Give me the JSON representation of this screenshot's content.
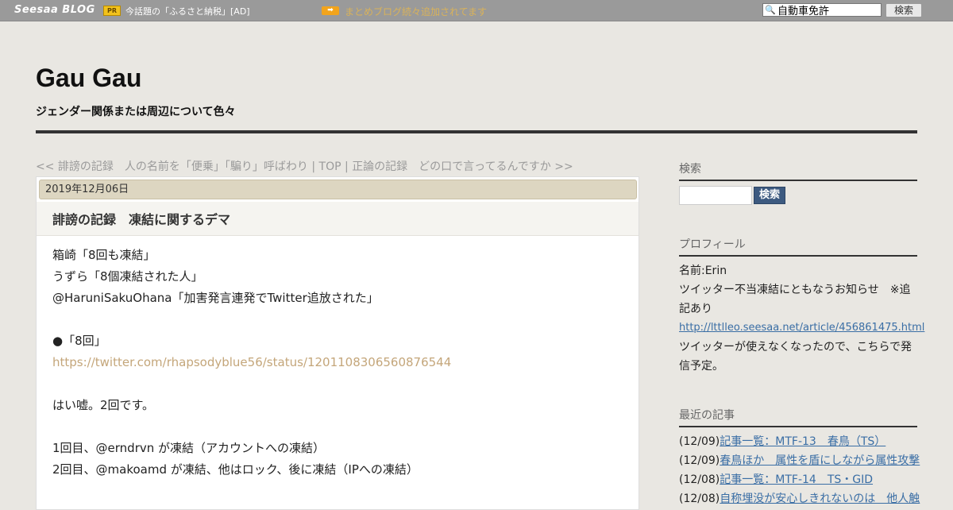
{
  "topbar": {
    "logo": "Seesaa BLOG",
    "pr_badge": "PR",
    "ad_text": "今話題の「ふるさと納税」[AD]",
    "arrow_badge": "➡",
    "notice_link": "まとめブログ続々追加されてます",
    "search_value": "自動車免許",
    "search_button": "検索"
  },
  "header": {
    "title": "Gau Gau",
    "subtitle": "ジェンダー関係または周辺について色々"
  },
  "nav": {
    "prev": "<< 誹謗の記録　人の名前を「便乗」「騙り」呼ばわり",
    "sep1": " | ",
    "top": "TOP",
    "sep2": " | ",
    "next": "正論の記録　どの口で言ってるんですか >>"
  },
  "article": {
    "date": "2019年12月06日",
    "title": "誹謗の記録　凍結に関するデマ",
    "lines": [
      "箱崎「8回も凍結」",
      "うずら「8個凍結された人」",
      "@HaruniSakuOhana「加害発言連発でTwitter追放された」",
      "",
      "●「8回」",
      "https://twitter.com/rhapsodyblue56/status/1201108306560876544",
      "",
      "はい嘘。2回です。",
      "",
      "1回目、@erndrvn が凍結（アカウントへの凍結）",
      "2回目、@makoamd が凍結、他はロック、後に凍結（IPへの凍結）"
    ]
  },
  "sidebar": {
    "search_heading": "検索",
    "search_button": "検索",
    "profile_heading": "プロフィール",
    "profile_name": "名前:Erin",
    "profile_notice": "ツイッター不当凍結にともなうお知らせ　※追記あり",
    "profile_link": "http://lttlleo.seesaa.net/article/456861475.html",
    "profile_note": "ツイッターが使えなくなったので、こちらで発信予定。",
    "recent_heading": "最近の記事",
    "recent": [
      {
        "date": "(12/09)",
        "title": "記事一覧：MTF-13　春鳥（TS）"
      },
      {
        "date": "(12/09)",
        "title": "春鳥ほか　属性を盾にしながら属性攻撃"
      },
      {
        "date": "(12/08)",
        "title": "記事一覧：MTF-14　TS・GID"
      },
      {
        "date": "(12/08)",
        "title": "自称埋没が安心しきれないのは　他人触"
      }
    ]
  }
}
